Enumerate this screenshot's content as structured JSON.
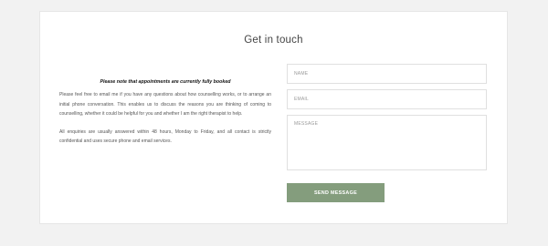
{
  "contact": {
    "title": "Get in touch",
    "notice": "Please note that appointments are currently fully booked",
    "paragraphs": [
      "Please feel free to email me if you have any questions about how counselling works, or to arrange an initial phone conversation. This enables us to discuss the reasons you are thinking of coming to counselling, whether it could be helpful for you and whether I am the right therapist to help.",
      "All enquiries are usually answered within 48 hours, Monday to Friday, and all contact is strictly confidential and uses secure phone and email services."
    ]
  },
  "form": {
    "name_placeholder": "NAME",
    "email_placeholder": "EMAIL",
    "message_placeholder": "MESSAGE",
    "name_value": "",
    "email_value": "",
    "message_value": "",
    "submit_label": "SEND MESSAGE"
  },
  "colors": {
    "button_bg": "#849d7d",
    "button_text": "#ffffff",
    "page_bg": "#f2f2f2",
    "card_bg": "#ffffff"
  }
}
